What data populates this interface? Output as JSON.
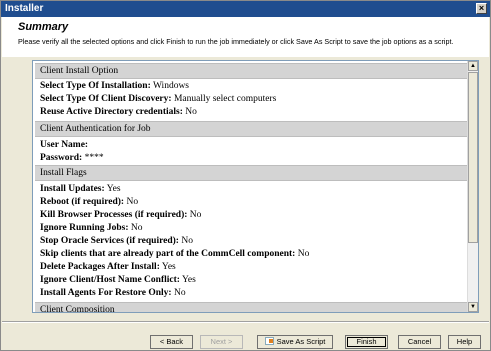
{
  "window": {
    "title": "Installer",
    "close_glyph": "×"
  },
  "header": {
    "title": "Summary",
    "instructions": "Please verify all the selected options and click Finish to run the job immediately or click Save As Script to save the job options as a script."
  },
  "sections": {
    "client_install_option": {
      "label": "Client Install Option"
    },
    "client_authentication": {
      "label": "Client Authentication for Job"
    },
    "install_flags": {
      "label": "Install Flags"
    },
    "client_composition": {
      "label": "Client Composition"
    }
  },
  "rows": {
    "type_of_installation": {
      "key": "Select Type Of Installation:",
      "value": "Windows"
    },
    "type_of_discovery": {
      "key": "Select Type Of Client Discovery:",
      "value": "Manually select computers"
    },
    "reuse_ad": {
      "key": "Reuse Active Directory credentials:",
      "value": "No"
    },
    "user_name": {
      "key": "User Name:",
      "value": ""
    },
    "password": {
      "key": "Password:",
      "value": "****"
    },
    "install_updates": {
      "key": "Install Updates:",
      "value": "Yes"
    },
    "reboot": {
      "key": "Reboot (if required):",
      "value": "No"
    },
    "kill_browser": {
      "key": "Kill Browser Processes (if required):",
      "value": "No"
    },
    "ignore_running": {
      "key": "Ignore Running Jobs:",
      "value": "No"
    },
    "stop_oracle": {
      "key": "Stop Oracle Services (if required):",
      "value": "No"
    },
    "skip_clients": {
      "key": "Skip clients that are already part of the CommCell component:",
      "value": "No"
    },
    "delete_packages": {
      "key": "Delete Packages After Install:",
      "value": "Yes"
    },
    "ignore_conflict": {
      "key": "Ignore Client/Host Name Conflict:",
      "value": "Yes"
    },
    "install_agents": {
      "key": "Install Agents For Restore Only:",
      "value": "No"
    }
  },
  "scrollbar": {
    "up_glyph": "▲",
    "down_glyph": "▼"
  },
  "buttons": {
    "back": "< Back",
    "next": "Next >",
    "save_script": "Save As Script",
    "finish": "Finish",
    "cancel": "Cancel",
    "help": "Help"
  }
}
